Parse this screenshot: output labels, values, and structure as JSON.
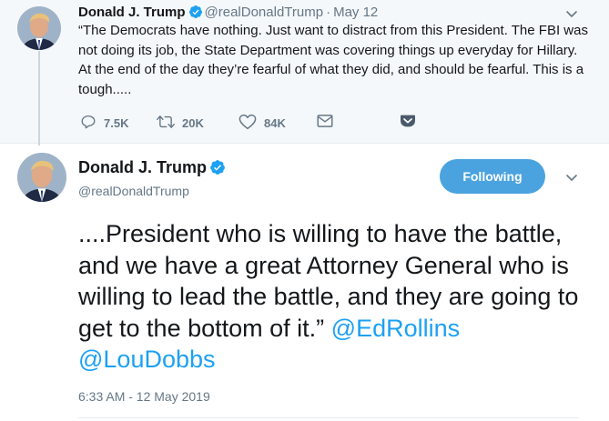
{
  "parent_tweet": {
    "author_name": "Donald J. Trump",
    "handle": "@realDonaldTrump",
    "separator": "·",
    "date": "May 12",
    "text": "“The Democrats have nothing. Just want to distract from this President. The FBI was not doing its job, the State Department was covering things up everyday for Hillary. At the end of the day they’re fearful of what they did, and should be fearful. This is a tough.....",
    "reply_count": "7.5K",
    "retweet_count": "20K",
    "like_count": "84K"
  },
  "main_tweet": {
    "author_name": "Donald J. Trump",
    "handle": "@realDonaldTrump",
    "follow_label": "Following",
    "text": "....President who is willing to have the battle, and we have a great Attorney General who is willing to lead the battle, and they are going to get to the bottom of it.”",
    "mention_1": "@EdRollins",
    "mention_2": "@LouDobbs",
    "timestamp": "6:33 AM - 12 May 2019"
  },
  "colors": {
    "accent": "#1da1f2",
    "follow_button": "#4aa3df",
    "muted_text": "#657786",
    "parent_background": "#f5f8fa"
  },
  "icons": {
    "verified": "verified-badge-icon",
    "reply": "reply-icon",
    "retweet": "retweet-icon",
    "like": "heart-icon",
    "dm": "envelope-icon",
    "pocket": "pocket-icon",
    "more": "chevron-down-icon"
  }
}
